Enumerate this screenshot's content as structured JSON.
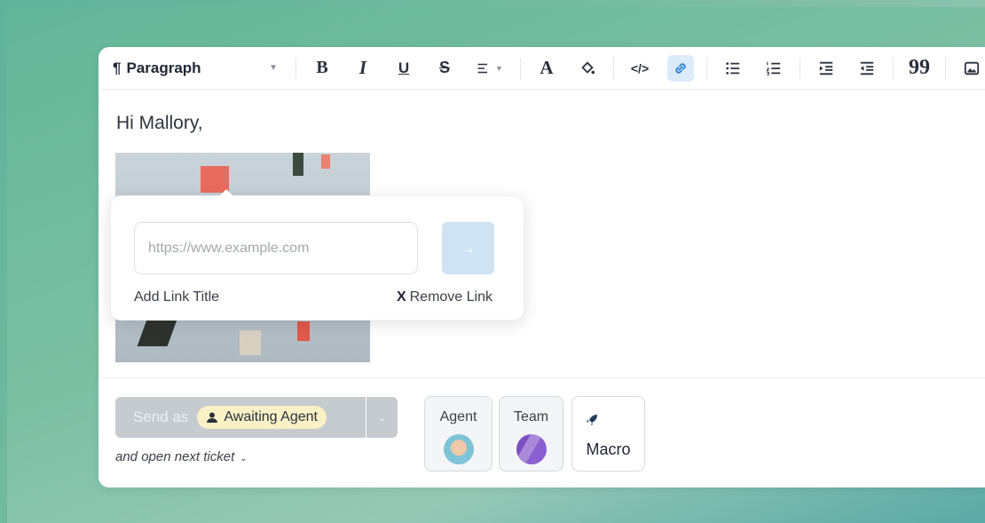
{
  "toolbar": {
    "block_style": "Paragraph",
    "icons": {
      "bold": "B",
      "italic": "I",
      "underline": "U",
      "strikethrough": "S",
      "font_color": "A",
      "quote": "99",
      "code": "</>"
    }
  },
  "editor": {
    "greeting": "Hi Mallory,"
  },
  "link_popup": {
    "url_placeholder": "https://www.example.com",
    "url_value": "",
    "submit_icon": "→",
    "add_title_label": "Add Link Title",
    "remove_x": "X",
    "remove_label": "Remove Link"
  },
  "composer": {
    "send_label": "Send as",
    "status_label": "Awaiting Agent",
    "open_next_label": "and open next ticket",
    "tiles": {
      "agent": "Agent",
      "team": "Team",
      "macro": "Macro"
    }
  },
  "colors": {
    "accent": "#2b7fd4",
    "status_pill_bg": "#fbf1c7",
    "send_button_bg": "#c6cbd0"
  }
}
